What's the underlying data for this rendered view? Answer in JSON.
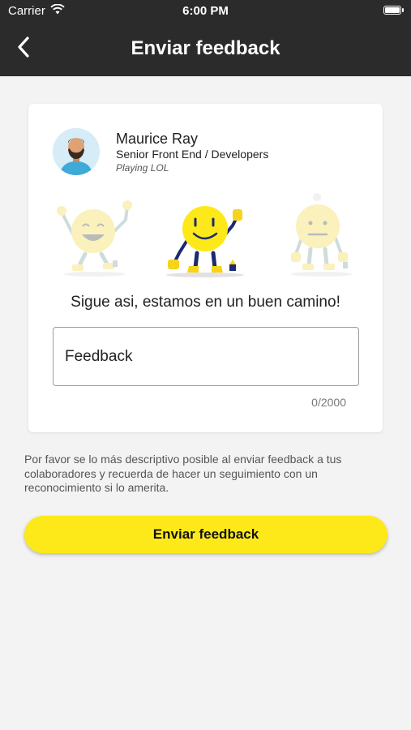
{
  "status_bar": {
    "carrier": "Carrier",
    "time": "6:00 PM",
    "icons": [
      "wifi-icon",
      "battery-icon"
    ]
  },
  "header": {
    "title": "Enviar feedback",
    "back_icon": "chevron-left-icon"
  },
  "card": {
    "user": {
      "name": "Maurice Ray",
      "role": "Senior Front End / Developers",
      "status": "Playing LOL",
      "avatar_icon": "avatar-icon"
    },
    "emoji_options": [
      {
        "mood": "happy",
        "icon": "happy-emoji-icon"
      },
      {
        "mood": "good",
        "icon": "smile-emoji-icon",
        "selected": true
      },
      {
        "mood": "neutral",
        "icon": "neutral-emoji-icon"
      }
    ],
    "message": "Sigue asi, estamos en un buen camino!",
    "feedback_input": {
      "placeholder": "Feedback",
      "value": ""
    },
    "char_counter": "0/2000"
  },
  "help_text": "Por favor se lo más descriptivo posible al enviar feedback a tus colaboradores y recuerda de hacer un seguimiento con un reconocimiento si lo amerita.",
  "submit_button": {
    "label": "Enviar feedback"
  },
  "colors": {
    "header_bg": "#2b2b2b",
    "accent_yellow": "#fde91a",
    "page_bg": "#f3f3f3"
  }
}
